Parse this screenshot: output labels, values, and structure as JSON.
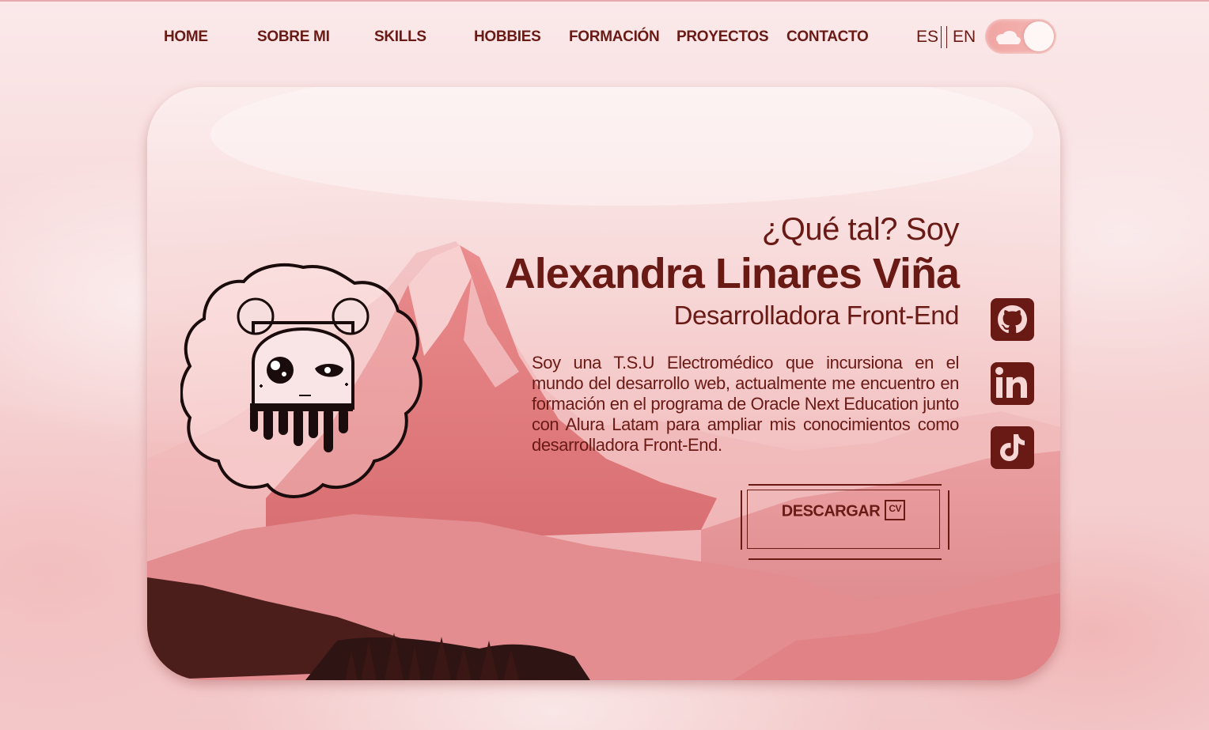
{
  "nav": {
    "items": [
      {
        "label": "HOME"
      },
      {
        "label": "SOBRE MI"
      },
      {
        "label": "SKILLS"
      },
      {
        "label": "HOBBIES"
      },
      {
        "label": "FORMACIÓN"
      },
      {
        "label": "PROYECTOS"
      },
      {
        "label": "CONTACTO"
      }
    ],
    "lang_es": "ES",
    "lang_en": "EN",
    "theme_toggle_icon": "cloud-icon"
  },
  "hero": {
    "greeting": "¿Qué tal? Soy",
    "name": "Alexandra Linares Viña",
    "role": "Desarrolladora Front-End",
    "bio": "Soy una T.S.U Electromédico que incursiona en el mundo del desarrollo web, actualmente me encuentro en formación en el programa de Oracle Next Education junto con Alura Latam para ampliar mis conocimientos como desarrolladora Front-End.",
    "cv_button_label": "DESCARGAR",
    "cv_icon_text": "CV",
    "avatar_icon": "cartoon-avatar-icon"
  },
  "social": [
    {
      "icon": "github-icon"
    },
    {
      "icon": "linkedin-icon"
    },
    {
      "icon": "tiktok-icon"
    }
  ],
  "colors": {
    "accent": "#6a1a15",
    "background": "#f6d3d4",
    "toggle": "#f0a5a2"
  }
}
